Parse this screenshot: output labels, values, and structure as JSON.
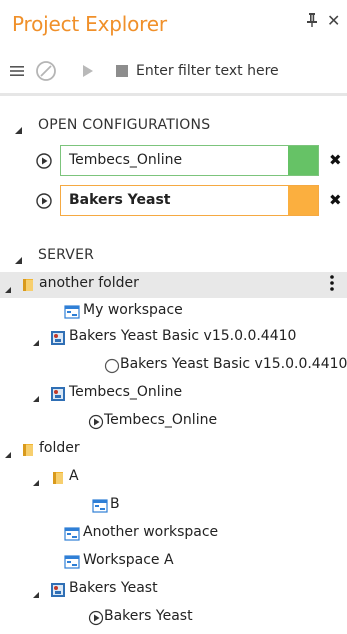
{
  "panel": {
    "title": "Project Explorer",
    "pin_glyph": "ф",
    "close_glyph": "✕"
  },
  "toolbar": {
    "filter_placeholder": "Enter filter text here",
    "icons": [
      "menu-icon",
      "disabled-circle-icon",
      "play-icon",
      "stop-icon"
    ]
  },
  "open_configurations": {
    "label": "OPEN CONFIGURATIONS",
    "items": [
      {
        "name": "Tembecs_Online",
        "color": "#66c266",
        "border": "#7cc47c",
        "bold": false
      },
      {
        "name": "Bakers Yeast",
        "color": "#fbaf3f",
        "border": "#f5a942",
        "bold": true
      }
    ],
    "remove_glyph": "✖"
  },
  "server": {
    "label": "SERVER",
    "tree": [
      {
        "label": "another folder",
        "type": "folder",
        "expanded": true
      },
      {
        "label": "My workspace",
        "type": "workspace"
      },
      {
        "label": "Bakers Yeast Basic v15.0.0.4410",
        "type": "project",
        "expanded": true
      },
      {
        "label": "Bakers Yeast Basic v15.0.0.4410",
        "type": "config-idle"
      },
      {
        "label": "Tembecs_Online",
        "type": "project",
        "expanded": true
      },
      {
        "label": "Tembecs_Online",
        "type": "config-running"
      },
      {
        "label": "folder",
        "type": "folder",
        "expanded": true
      },
      {
        "label": "A",
        "type": "folder",
        "expanded": true
      },
      {
        "label": "B",
        "type": "workspace"
      },
      {
        "label": "Another workspace",
        "type": "workspace"
      },
      {
        "label": "Workspace A",
        "type": "workspace"
      },
      {
        "label": "Bakers Yeast",
        "type": "project",
        "expanded": true
      },
      {
        "label": "Bakers Yeast",
        "type": "config-running"
      }
    ]
  },
  "colors": {
    "accent": "#f0902a",
    "selected_row": "#e8e8e8",
    "workspace_blue": "#2f7fd6",
    "folder_yellow": "#f2b632"
  }
}
